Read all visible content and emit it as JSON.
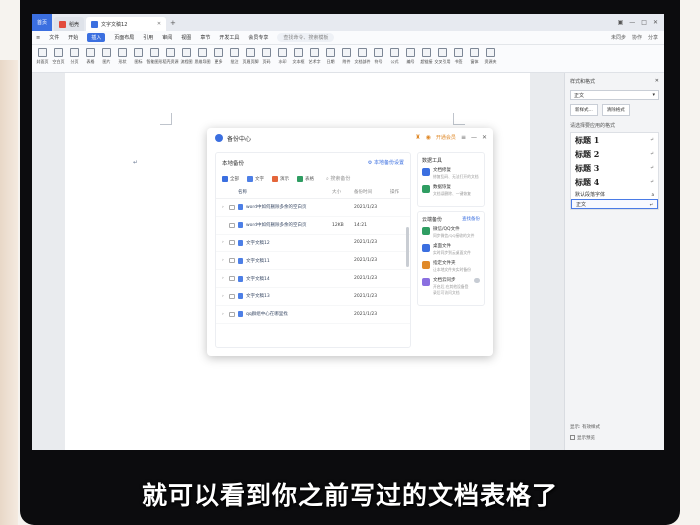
{
  "app": {
    "home_tab": "首页",
    "tabs": [
      {
        "label": "稻壳",
        "icon": "daoke-icon",
        "active": false
      },
      {
        "label": "文字文稿12",
        "icon": "word-doc-icon",
        "active": true
      }
    ]
  },
  "menu": {
    "file": "文件",
    "items": [
      "开始",
      "插入",
      "页面布局",
      "引用",
      "审阅",
      "视图",
      "章节",
      "开发工具",
      "会员专享"
    ],
    "search": "查找命令、搜索模板",
    "right": [
      "未同步",
      "协作",
      "分享"
    ]
  },
  "toolbar": {
    "tools": [
      "封面页",
      "空白页",
      "分页",
      "表格",
      "图片",
      "形状",
      "图标",
      "智能图形",
      "稻壳资源",
      "流程图",
      "思维导图",
      "更多",
      "批注",
      "页眉页脚",
      "页码",
      "水印",
      "文本框",
      "艺术字",
      "日期",
      "附件",
      "文档部件",
      "符号",
      "公式",
      "编号",
      "超链接",
      "交叉引用",
      "书签",
      "窗体",
      "资源夹"
    ]
  },
  "dialog": {
    "title": "备份中心",
    "vip": "开通会员",
    "left": {
      "title": "本地备份",
      "settings": "本地备份设置",
      "filters": [
        {
          "label": "全部",
          "cls": "all"
        },
        {
          "label": "文字",
          "cls": "word"
        },
        {
          "label": "演示",
          "cls": "ppt"
        },
        {
          "label": "表格",
          "cls": "xls"
        }
      ],
      "search_placeholder": "搜索备份",
      "columns": [
        "名称",
        "大小",
        "备份时间",
        "操作"
      ],
      "rows": [
        {
          "expand": true,
          "name": "word中如何删除多余的空白页",
          "size": "",
          "time": "2021/1/23"
        },
        {
          "expand": false,
          "name": "word中如何删除多余的空白页",
          "size": "12KB",
          "time": "14:21"
        },
        {
          "expand": true,
          "name": "文字文稿12",
          "size": "",
          "time": "2021/1/23"
        },
        {
          "expand": true,
          "name": "文字文稿11",
          "size": "",
          "time": "2021/1/23"
        },
        {
          "expand": true,
          "name": "文字文稿14",
          "size": "",
          "time": "2021/1/23"
        },
        {
          "expand": true,
          "name": "文字文稿13",
          "size": "",
          "time": "2021/1/23"
        },
        {
          "expand": true,
          "name": "qq群组中心在哪里找",
          "size": "",
          "time": "2021/1/23"
        }
      ]
    },
    "right": {
      "tools_title": "数据工具",
      "tools": [
        {
          "name": "文档修复",
          "desc": "修复乱码、无法打开的文档",
          "color": "#3b6fe0"
        },
        {
          "name": "数据恢复",
          "desc": "文档误删除、一键恢复",
          "color": "#2f9d62"
        }
      ],
      "cloud_title": "云端备份",
      "cloud_link": "查找备份",
      "cloud": [
        {
          "name": "微信/QQ文件",
          "desc": "同步微信/QQ接收的文件",
          "color": "#2f9d62"
        },
        {
          "name": "桌面文件",
          "desc": "实时同步到云桌面文件",
          "color": "#3b6fe0"
        },
        {
          "name": "指定文件夹",
          "desc": "让本地文件夹实时备份",
          "color": "#e08a2a"
        },
        {
          "name": "文档云同步",
          "desc": "开启后,在其他设备登录后可访问文档",
          "color": "#8a6fe0"
        }
      ]
    }
  },
  "right_panel": {
    "title": "样式和格式",
    "current_style": "正文",
    "new_style": "新样式...",
    "clear_format": "清除格式",
    "apply_label": "请选择要应用的格式",
    "headings": [
      "标题 1",
      "标题 2",
      "标题 3",
      "标题 4"
    ],
    "default_para": "默认段落字体",
    "body": "正文",
    "show_label": "显示:",
    "show_value": "有效样式",
    "preview": "显示预览"
  },
  "subtitle": "就可以看到你之前写过的文档表格了"
}
